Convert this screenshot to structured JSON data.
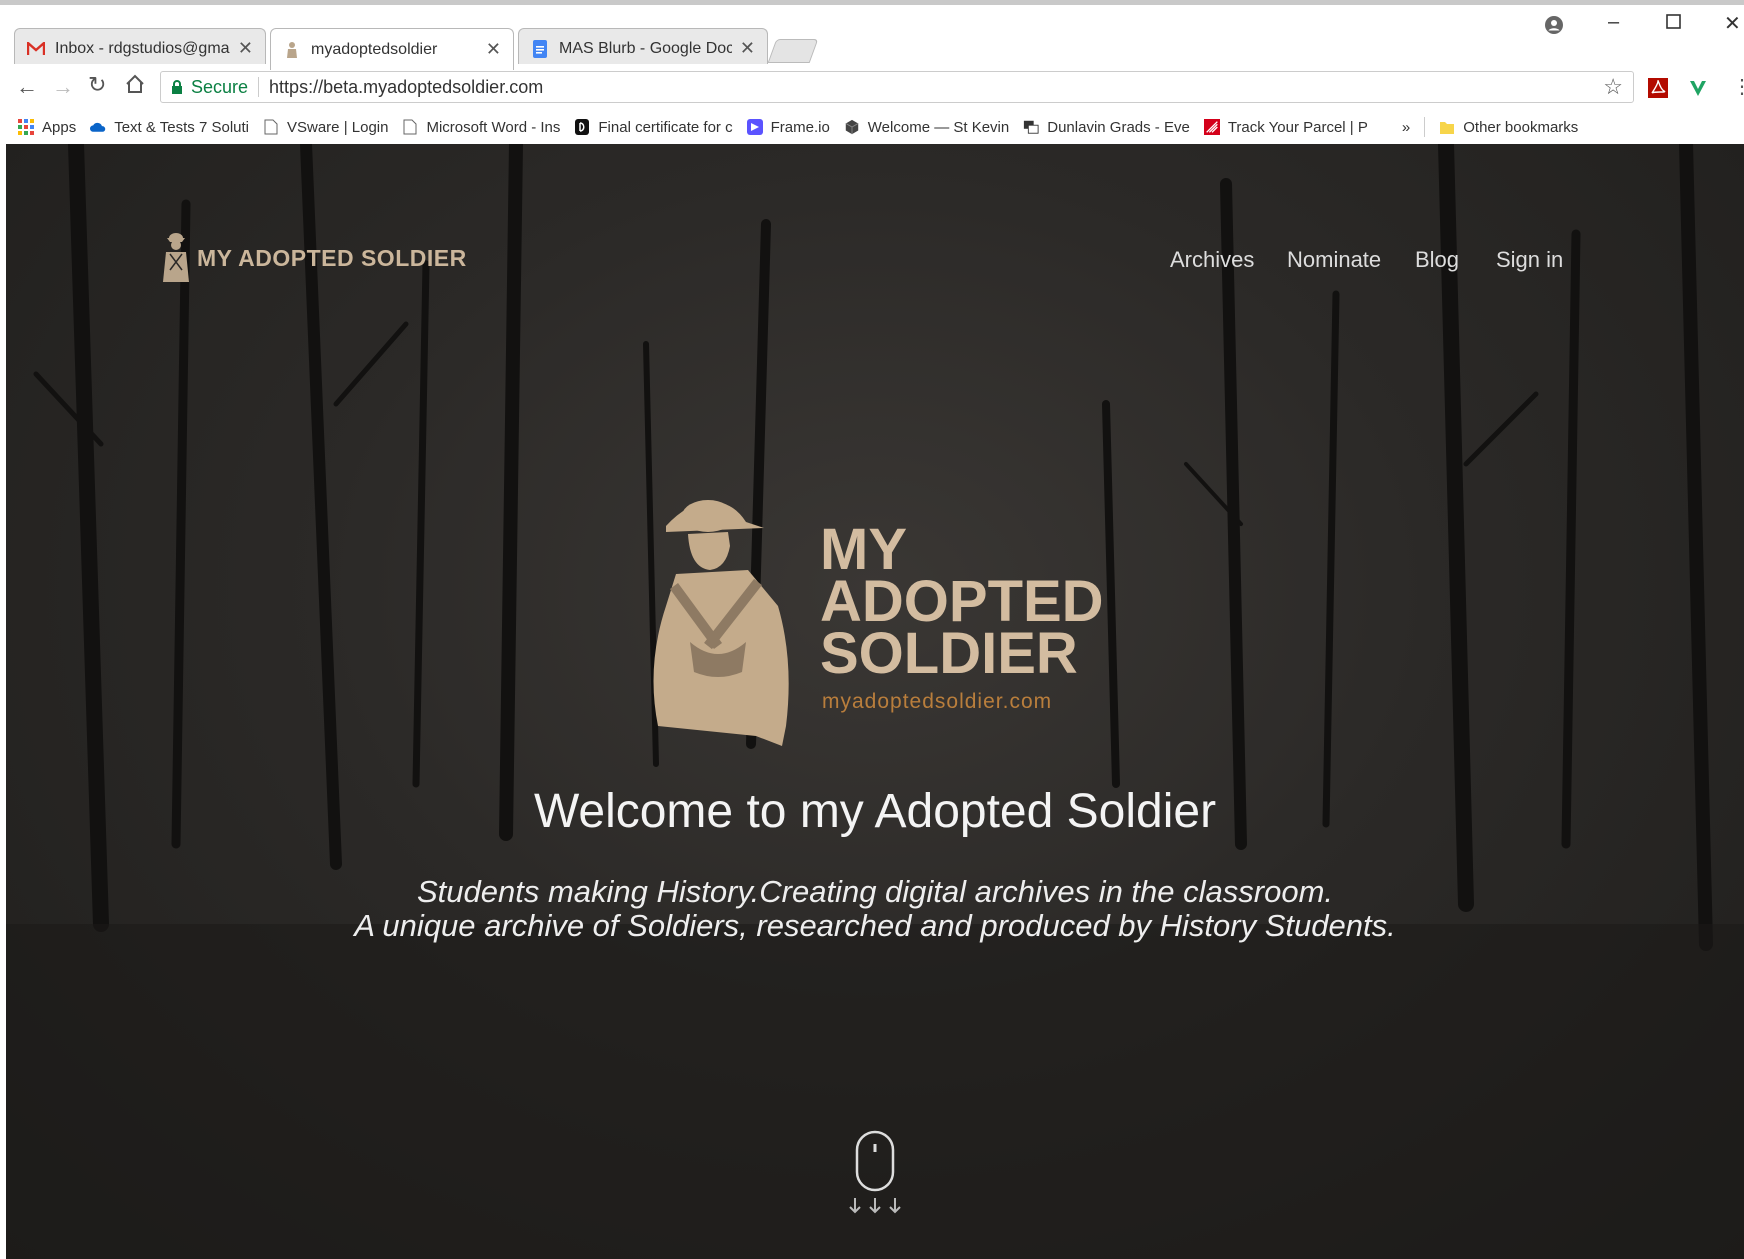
{
  "browser": {
    "tabs": [
      {
        "label": "Inbox - rdgstudios@gma",
        "icon": "gmail-icon"
      },
      {
        "label": "myadoptedsoldier",
        "icon": "soldier-favicon",
        "active": true
      },
      {
        "label": "MAS Blurb - Google Doc",
        "icon": "docs-icon"
      }
    ],
    "secure_label": "Secure",
    "url": "https://beta.myadoptedsoldier.com",
    "bookmarks": [
      {
        "label": "Apps",
        "icon": "apps-grid-icon"
      },
      {
        "label": "Text & Tests 7 Soluti",
        "icon": "cloud-icon"
      },
      {
        "label": "VSware | Login",
        "icon": "page-icon"
      },
      {
        "label": "Microsoft Word - Ins",
        "icon": "page-icon"
      },
      {
        "label": "Final certificate for c",
        "icon": "dark-icon"
      },
      {
        "label": "Frame.io",
        "icon": "frameio-icon"
      },
      {
        "label": "Welcome — St Kevin",
        "icon": "cube-icon"
      },
      {
        "label": "Dunlavin Grads - Eve",
        "icon": "window-icon"
      },
      {
        "label": "Track Your Parcel | P",
        "icon": "parcel-icon"
      }
    ],
    "overflow_label": "»",
    "other_bookmarks": "Other bookmarks"
  },
  "site": {
    "logo_text": "MY ADOPTED SOLDIER",
    "nav": [
      "Archives",
      "Nominate",
      "Blog",
      "Sign in"
    ],
    "hero_logo_lines": [
      "MY",
      "ADOPTED",
      "SOLDIER"
    ],
    "hero_logo_url": "myadoptedsoldier.com",
    "welcome": "Welcome to my Adopted Soldier",
    "tagline_1": "Students making History.Creating digital archives in the classroom.",
    "tagline_2": "A unique archive of Soldiers, researched and produced by History Students."
  },
  "colors": {
    "logo_tan": "#d3bca0",
    "logo_url_orange": "#b97e3c",
    "secure_green": "#0b8043"
  }
}
